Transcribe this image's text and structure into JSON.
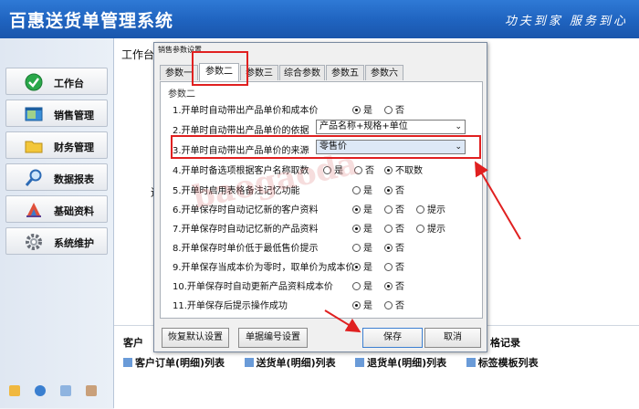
{
  "header": {
    "title": "百惠送货单管理系统",
    "slogan": "功夫到家 服务到心"
  },
  "sidebar": {
    "items": [
      {
        "label": "工作台",
        "icon": "check-circle-icon"
      },
      {
        "label": "销售管理",
        "icon": "window-icon"
      },
      {
        "label": "财务管理",
        "icon": "folder-icon"
      },
      {
        "label": "数据报表",
        "icon": "magnifier-icon"
      },
      {
        "label": "基础资料",
        "icon": "ruler-icon"
      },
      {
        "label": "系统维护",
        "icon": "gear-icon"
      }
    ]
  },
  "main": {
    "workbench_label": "工作台",
    "ghost_char": "退",
    "bottom": {
      "row1_left": "客户",
      "row1_right": "格记录",
      "links": [
        "客户订单(明细)列表",
        "送货单(明细)列表",
        "退货单(明细)列表",
        "标签模板列表"
      ]
    }
  },
  "dialog": {
    "title": "销售参数设置",
    "tabs": [
      "参数一",
      "参数二",
      "参数三",
      "综合参数",
      "参数五",
      "参数六"
    ],
    "group_label": "参数二",
    "rows": [
      {
        "label": "1.开单时自动带出产品单价和成本价",
        "options": [
          "是",
          "否"
        ]
      },
      {
        "label": "2.开单时自动带出产品单价的依据",
        "select": "产品名称+规格+单位"
      },
      {
        "label": "3.开单时自动带出产品单价的来源",
        "select": "零售价"
      },
      {
        "label": "4.开单时备选项根据客户名称取数",
        "options": [
          "是",
          "否",
          "不取数"
        ]
      },
      {
        "label": "5.开单时启用表格备注记忆功能",
        "options": [
          "是",
          "否"
        ]
      },
      {
        "label": "6.开单保存时自动记忆新的客户资料",
        "options": [
          "是",
          "否",
          "提示"
        ]
      },
      {
        "label": "7.开单保存时自动记忆新的产品资料",
        "options": [
          "是",
          "否",
          "提示"
        ]
      },
      {
        "label": "8.开单保存时单价低于最低售价提示",
        "options": [
          "是",
          "否"
        ]
      },
      {
        "label": "9.开单保存当成本价为零时，取单价为成本价",
        "options": [
          "是",
          "否"
        ]
      },
      {
        "label": "10.开单保存时自动更新产品资料成本价",
        "options": [
          "是",
          "否"
        ]
      },
      {
        "label": "11.开单保存后提示操作成功",
        "options": [
          "是",
          "否"
        ]
      }
    ],
    "buttons": {
      "reset": "恢复默认设置",
      "numbering": "单据编号设置",
      "save": "保存",
      "cancel": "取消"
    }
  },
  "watermark": "baogaoda",
  "colors": {
    "header_bg": "#1f63bf",
    "annotation_red": "#e02020"
  }
}
